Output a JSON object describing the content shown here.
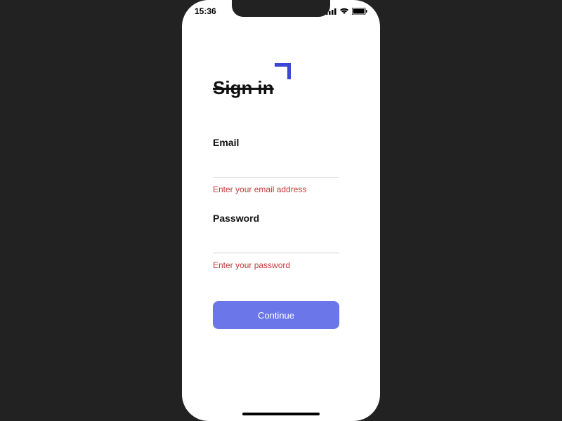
{
  "status_bar": {
    "time": "15:36"
  },
  "form": {
    "title": "Sign in",
    "email": {
      "label": "Email",
      "value": "",
      "error": "Enter your email address"
    },
    "password": {
      "label": "Password",
      "value": "",
      "error": "Enter your password"
    },
    "submit_label": "Continue"
  },
  "colors": {
    "accent": "#6b76e8",
    "corner_accent": "#3b46d6",
    "error": "#c33b3b",
    "background": "#222222"
  }
}
